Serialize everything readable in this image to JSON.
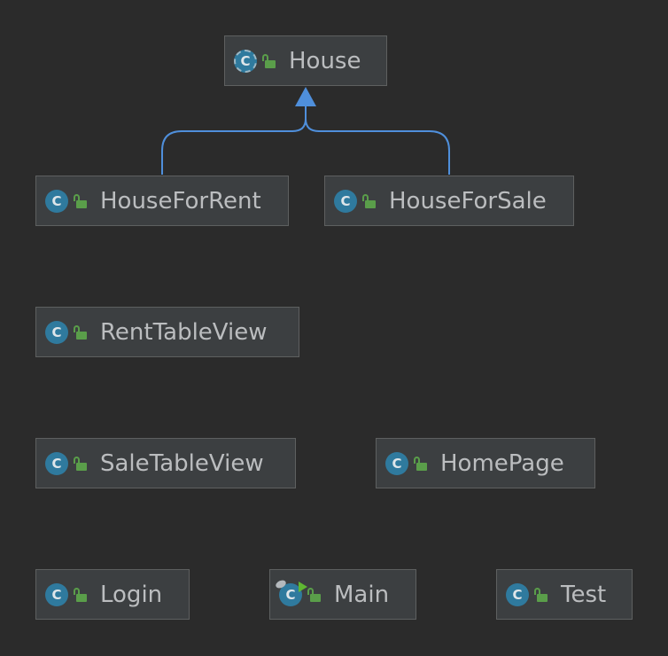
{
  "diagram": {
    "classes": [
      {
        "name": "House",
        "kind": "abstract"
      },
      {
        "name": "HouseForRent",
        "kind": "class"
      },
      {
        "name": "HouseForSale",
        "kind": "class"
      },
      {
        "name": "RentTableView",
        "kind": "class"
      },
      {
        "name": "SaleTableView",
        "kind": "class"
      },
      {
        "name": "HomePage",
        "kind": "class"
      },
      {
        "name": "Login",
        "kind": "class"
      },
      {
        "name": "Main",
        "kind": "main-class"
      },
      {
        "name": "Test",
        "kind": "class"
      }
    ],
    "class_icon_letter": "C",
    "edges": [
      {
        "from": "HouseForRent",
        "to": "House",
        "type": "extends"
      },
      {
        "from": "HouseForSale",
        "to": "House",
        "type": "extends"
      }
    ],
    "colors": {
      "background": "#2b2b2b",
      "node_fill": "#3c3f41",
      "node_border": "#5e6060",
      "text": "#bbbdbf",
      "class_icon": "#2f7a9e",
      "lock_icon": "#5a9e4a",
      "inheritance_edge": "#4f8fdb",
      "run_icon": "#5fb832"
    },
    "icons": {
      "class": "class-c-icon",
      "abstract": "abstract-class-icon",
      "main": "main-run-class-icon",
      "visibility": "public-lock-icon"
    }
  }
}
